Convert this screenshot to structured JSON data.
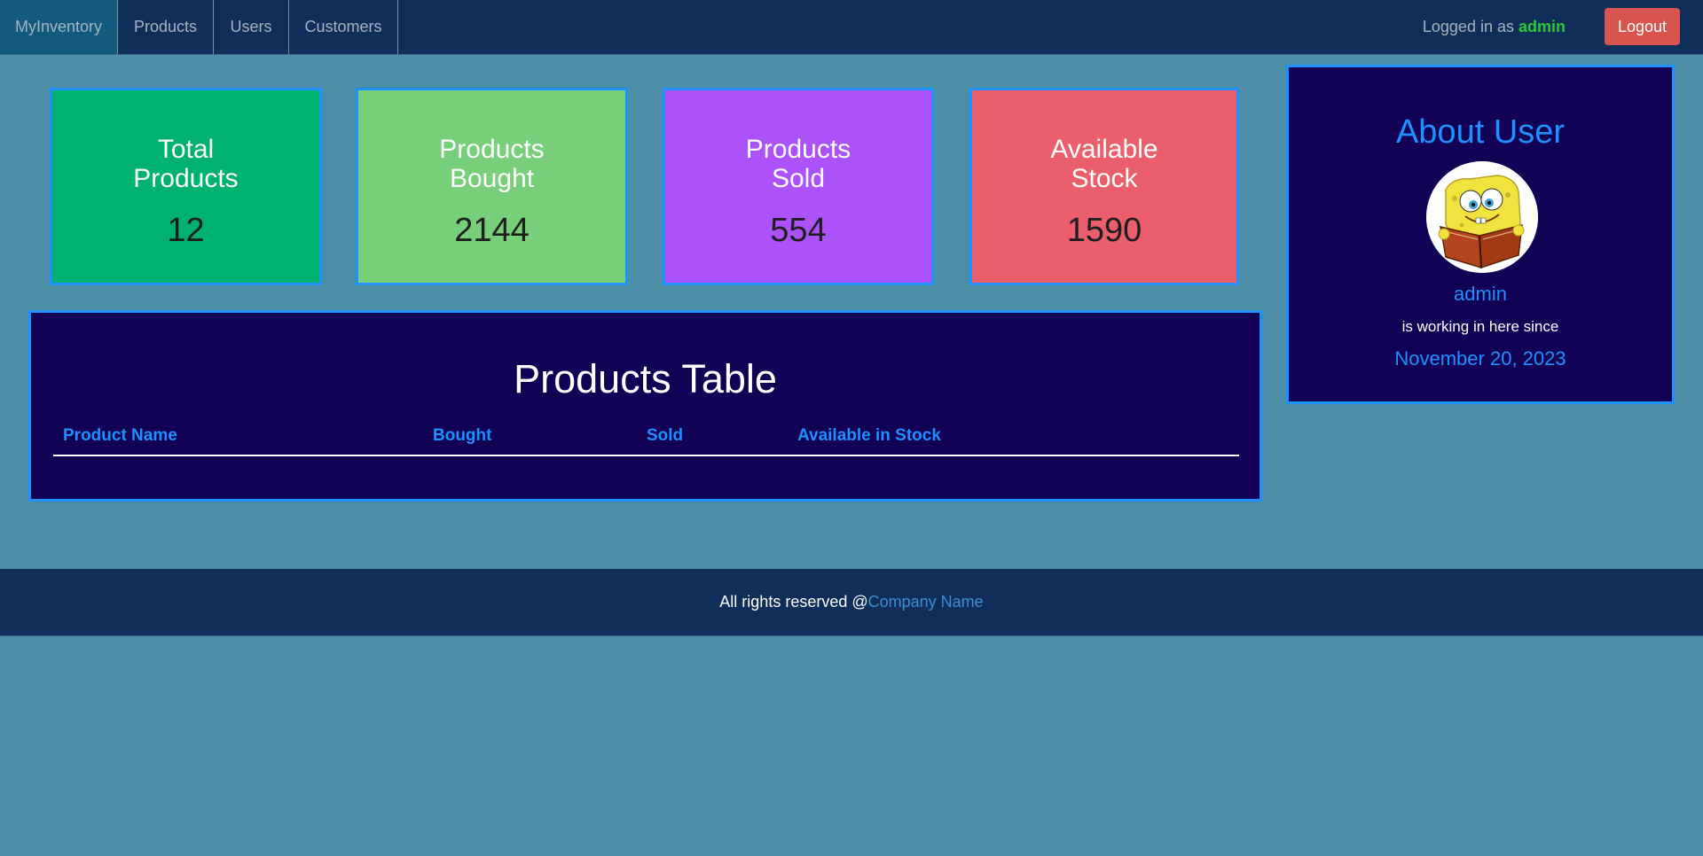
{
  "nav": {
    "brand": "MyInventory",
    "items": [
      "Products",
      "Users",
      "Customers"
    ],
    "logged_in_prefix": "Logged in as",
    "username": "admin",
    "logout_label": "Logout"
  },
  "cards": [
    {
      "title": "Total Products",
      "value": "12",
      "color": "#00b26f"
    },
    {
      "title": "Products Bought",
      "value": "2144",
      "color": "#77cf7a"
    },
    {
      "title": "Products Sold",
      "value": "554",
      "color": "#ab52fa"
    },
    {
      "title": "Available Stock",
      "value": "1590",
      "color": "#ea5f6b"
    }
  ],
  "products_table": {
    "title": "Products Table",
    "columns": [
      "Product Name",
      "Bought",
      "Sold",
      "Available in Stock"
    ],
    "rows": []
  },
  "about": {
    "title": "About User",
    "avatar_icon": "spongebob-avatar",
    "username": "admin",
    "since_label": "is working in here since",
    "since_date": "November 20, 2023"
  },
  "footer": {
    "text": "All rights reserved @",
    "link": "Company Name"
  }
}
